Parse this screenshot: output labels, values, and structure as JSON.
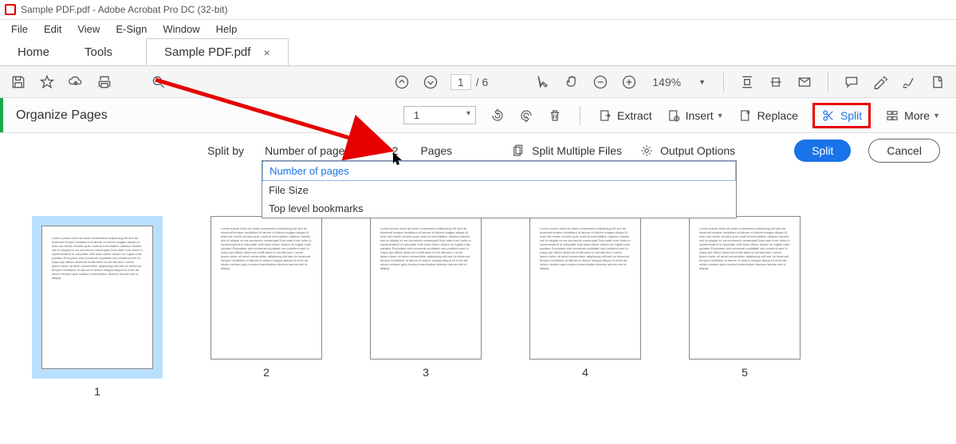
{
  "window": {
    "title": "Sample PDF.pdf - Adobe Acrobat Pro DC (32-bit)"
  },
  "menu": {
    "file": "File",
    "edit": "Edit",
    "view": "View",
    "esign": "E-Sign",
    "window": "Window",
    "help": "Help"
  },
  "tabs": {
    "home": "Home",
    "tools": "Tools",
    "doc": "Sample PDF.pdf"
  },
  "toolbar": {
    "current_page": "1",
    "total": "/ 6",
    "zoom": "149%"
  },
  "panel": {
    "title": "Organize Pages",
    "page_indicator": "1",
    "extract": "Extract",
    "insert": "Insert",
    "replace": "Replace",
    "split": "Split",
    "more": "More"
  },
  "splitrow": {
    "splitby": "Split by",
    "selected": "Number of pages",
    "options": [
      "Number of pages",
      "File Size",
      "Top level bookmarks"
    ],
    "count": "2",
    "pages": "Pages",
    "multiple": "Split Multiple Files",
    "output": "Output Options",
    "split_btn": "Split",
    "cancel_btn": "Cancel"
  },
  "thumbs": {
    "nums": [
      "1",
      "2",
      "3",
      "4",
      "5"
    ]
  }
}
